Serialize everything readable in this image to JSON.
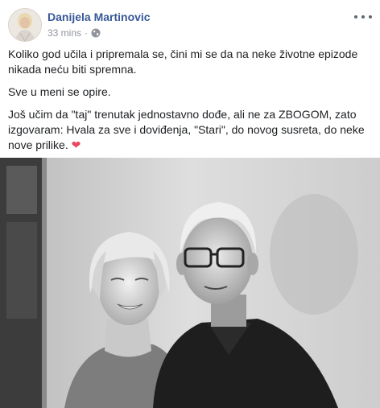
{
  "post": {
    "author": "Danijela Martinovic",
    "time": "33 mins",
    "separator": "·",
    "privacy_icon": "globe-icon",
    "menu_icon": "more-options-icon",
    "paragraphs": [
      "Koliko god učila i pripremala se, čini mi se da na neke životne epizode nikada neću biti spremna.",
      "Sve u meni se opire.",
      "Još učim da \"taj\" trenutak jednostavno dođe, ali ne za ZBOGOM, zato izgovaram: Hvala za sve i doviđenja, \"Stari\", do novog susreta, do neke nove prilike."
    ],
    "heart": "❤",
    "photo": "black-and-white photo of a smiling woman with a blonde bob haircut and an older man with white hair and glasses",
    "colors": {
      "author": "#385898",
      "meta": "#90949c",
      "text": "#1c1e21",
      "heart": "#e8475f"
    }
  }
}
